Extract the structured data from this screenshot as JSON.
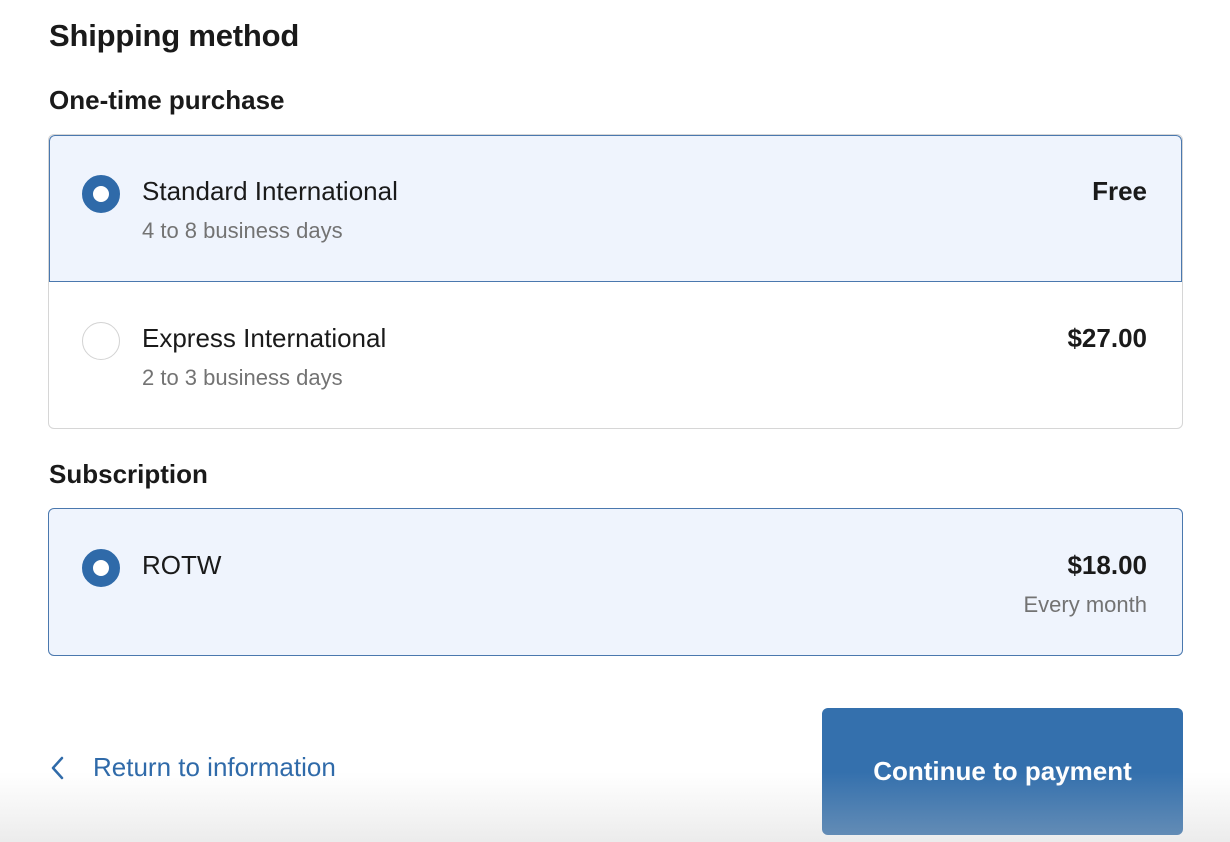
{
  "page": {
    "title": "Shipping method"
  },
  "one_time": {
    "heading": "One-time purchase",
    "options": [
      {
        "name": "Standard International",
        "detail": "4 to 8 business days",
        "price": "Free",
        "selected": true
      },
      {
        "name": "Express International",
        "detail": "2 to 3 business days",
        "price": "$27.00",
        "selected": false
      }
    ]
  },
  "subscription": {
    "heading": "Subscription",
    "options": [
      {
        "name": "ROTW",
        "price": "$18.00",
        "price_note": "Every month",
        "selected": true
      }
    ]
  },
  "footer": {
    "return_label": "Return to information",
    "return_icon": "chevron-left-icon",
    "continue_label": "Continue to payment"
  },
  "colors": {
    "accent": "#2f6aa9",
    "button": "#3470ad",
    "selected_bg": "#eff4fd",
    "muted_text": "#737373"
  }
}
